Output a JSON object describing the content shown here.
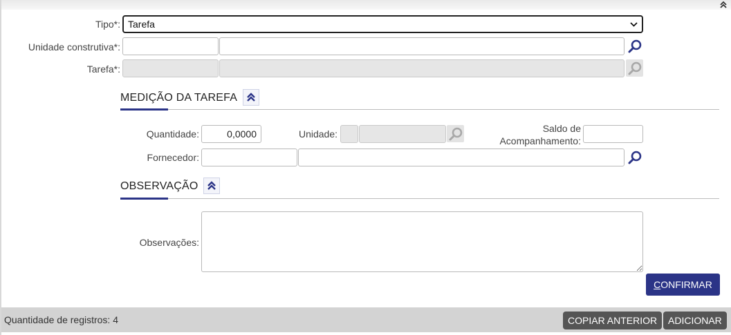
{
  "form": {
    "tipo": {
      "label": "Tipo*:",
      "selected": "Tarefa"
    },
    "unidade_construtiva": {
      "label": "Unidade construtiva*:",
      "code": "",
      "description": ""
    },
    "tarefa": {
      "label": "Tarefa*:",
      "code": "",
      "description": ""
    }
  },
  "medicao": {
    "title": "MEDIÇÃO DA TAREFA",
    "quantidade_label": "Quantidade:",
    "quantidade_value": "0,0000",
    "unidade_label": "Unidade:",
    "saldo_label_line1": "Saldo de",
    "saldo_label_line2": "Acompanhamento:",
    "saldo_value": "",
    "fornecedor_label": "Fornecedor:",
    "fornecedor_code": "",
    "fornecedor_name": ""
  },
  "observacao": {
    "title": "OBSERVAÇÃO",
    "label": "Observações:",
    "value": ""
  },
  "actions": {
    "confirm_first": "C",
    "confirm_rest": "ONFIRMAR"
  },
  "footer": {
    "count_label": "Quantidade de registros:",
    "count_value": "4",
    "copy_button": "COPIAR ANTERIOR",
    "add_button": "ADICIONAR"
  },
  "colors": {
    "primary": "#2b3487",
    "footer_bg": "#d3d3d3",
    "button_grey": "#555555"
  },
  "icons": {
    "search": "magnifier-icon",
    "collapse": "double-chevron-up-icon",
    "dropdown": "chevron-down-icon"
  }
}
